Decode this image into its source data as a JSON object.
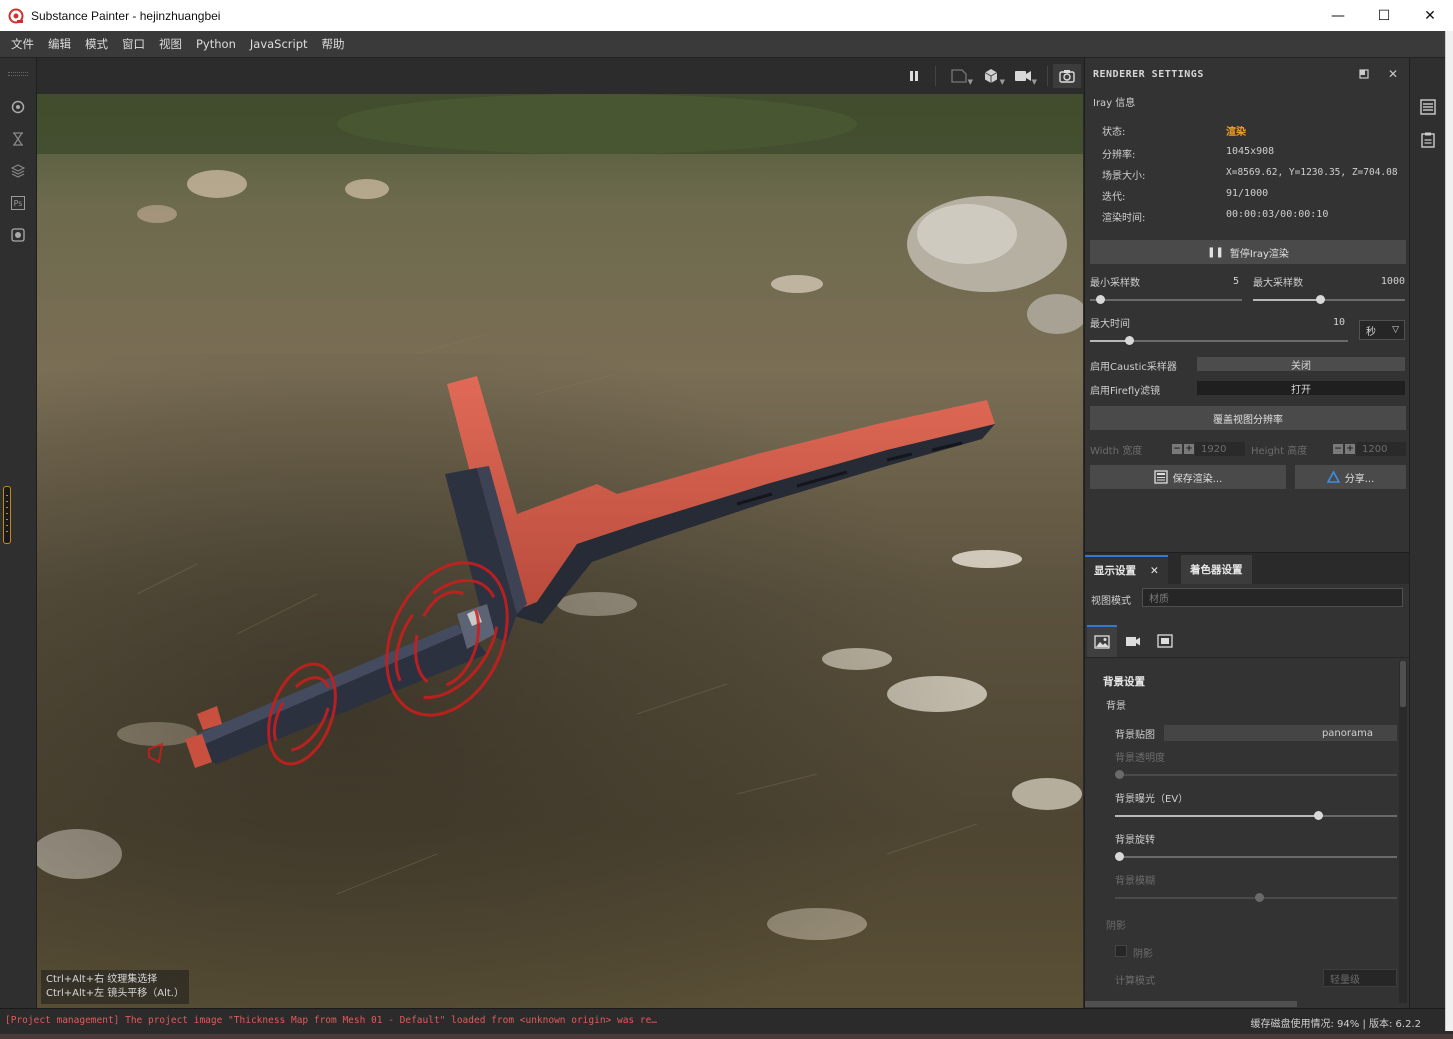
{
  "window": {
    "title": "Substance Painter - hejinzhuangbei",
    "minimize": "—",
    "maximize": "☐",
    "close": "✕"
  },
  "menu": [
    "文件",
    "编辑",
    "模式",
    "窗口",
    "视图",
    "Python",
    "JavaScript",
    "帮助"
  ],
  "viewport": {
    "toolbar_icons": [
      "pause-icon",
      "camera-frame-icon",
      "cube-icon",
      "video-camera-icon",
      "screenshot-camera-icon"
    ],
    "hints": [
      "Ctrl+Alt+右 纹理集选择",
      "Ctrl+Alt+左 镜头平移（Alt.）"
    ]
  },
  "left_toolbar_icons": [
    "shader-ball-icon",
    "hourglass-icon",
    "layer-stack-icon",
    "photoshop-icon",
    "camera-lens-icon"
  ],
  "right_toolbar_icons": [
    "layers-panel-icon",
    "notes-icon"
  ],
  "renderer": {
    "title": "RENDERER SETTINGS",
    "info_header": "Iray 信息",
    "status_label": "状态:",
    "status_value": "渲染",
    "resolution_label": "分辨率:",
    "resolution_value": "1045x908",
    "scene_size_label": "场景大小:",
    "scene_size_value": "X=8569.62,  Y=1230.35,  Z=704.08",
    "iterations_label": "迭代:",
    "iterations_value": "91/1000",
    "render_time_label": "渲染时间:",
    "render_time_value": "00:00:03/00:00:10",
    "pause_button": "暂停Iray渲染",
    "min_samples_label": "最小采样数",
    "min_samples_value": "5",
    "max_samples_label": "最大采样数",
    "max_samples_value": "1000",
    "max_time_label": "最大时间",
    "max_time_value": "10",
    "time_unit": "秒",
    "caustic_label": "启用Caustic采样器",
    "caustic_value": "关闭",
    "firefly_label": "启用Firefly滤镜",
    "firefly_value": "打开",
    "override_button": "覆盖视图分辨率",
    "width_label": "Width 宽度",
    "width_value": "1920",
    "height_label": "Height 高度",
    "height_value": "1200",
    "save_button": "保存渲染...",
    "share_button": "分享..."
  },
  "display": {
    "tab_display": "显示设置",
    "tab_shader": "着色器设置",
    "view_mode_label": "视图模式",
    "view_mode_value": "材质",
    "section_bg": "背景设置",
    "bg_group": "背景",
    "bg_map_label": "背景贴图",
    "bg_map_value": "panorama",
    "bg_opacity_label": "背景透明度",
    "bg_exposure_label": "背景曝光（EV）",
    "bg_rotation_label": "背景旋转",
    "bg_blur_label": "背景模糊",
    "shadow_group": "阴影",
    "shadow_label": "阴影",
    "calc_mode_label": "计算模式",
    "calc_mode_value": "轻量级"
  },
  "status": {
    "log": "[Project management] The project image \"Thickness Map from Mesh 01 - Default\" loaded from <unknown origin> was re…",
    "cache_usage": "缓存磁盘使用情况:   94%  |  版本:   6.2.2"
  },
  "colors": {
    "accent_blue": "#2e7bd6",
    "status_orange": "#f0a020",
    "log_red": "#e25a5a",
    "blade_red": "#d9604f"
  }
}
